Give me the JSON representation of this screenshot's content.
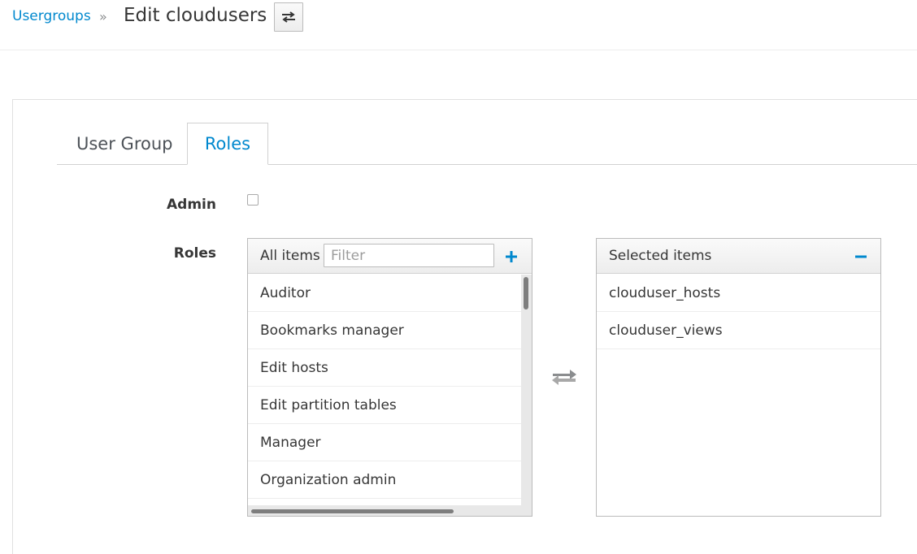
{
  "breadcrumb": {
    "parent": "Usergroups",
    "separator": "»",
    "title": "Edit cloudusers"
  },
  "icons": {
    "switch": "switch-arrows-icon",
    "add": "plus-icon",
    "remove": "minus-icon",
    "transfer": "transfer-arrows-icon"
  },
  "tabs": [
    {
      "label": "User Group",
      "active": false
    },
    {
      "label": "Roles",
      "active": true
    }
  ],
  "form": {
    "admin_label": "Admin",
    "admin_checked": false,
    "roles_label": "Roles"
  },
  "all_items": {
    "header": "All items",
    "filter_placeholder": "Filter",
    "items": [
      "Auditor",
      "Bookmarks manager",
      "Edit hosts",
      "Edit partition tables",
      "Manager",
      "Organization admin"
    ]
  },
  "selected_items": {
    "header": "Selected items",
    "items": [
      "clouduser_hosts",
      "clouduser_views"
    ]
  },
  "colors": {
    "accent": "#0088ce",
    "text": "#363636",
    "border": "#bbbbbb"
  }
}
